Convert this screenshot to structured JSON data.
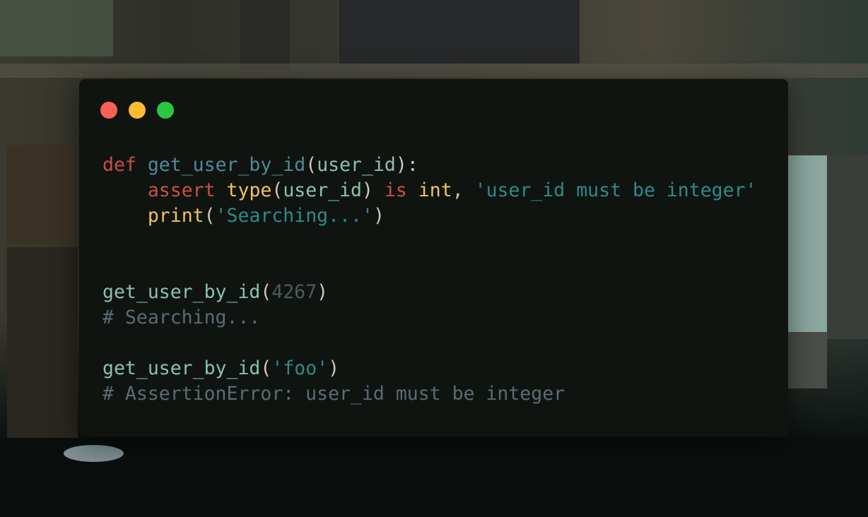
{
  "window": {
    "background": "#0f1411",
    "controls": [
      {
        "name": "close",
        "color": "#fe5f57"
      },
      {
        "name": "minimize",
        "color": "#febc2e"
      },
      {
        "name": "maximize",
        "color": "#28c840"
      }
    ]
  },
  "code": {
    "language": "python",
    "lines": [
      [
        {
          "t": "def",
          "k": "keyword"
        },
        {
          "t": " ",
          "k": "punct"
        },
        {
          "t": "get_user_by_id",
          "k": "function"
        },
        {
          "t": "(",
          "k": "punct"
        },
        {
          "t": "user_id",
          "k": "name"
        },
        {
          "t": "):",
          "k": "punct"
        }
      ],
      [
        {
          "t": "    ",
          "k": "punct"
        },
        {
          "t": "assert",
          "k": "keyword"
        },
        {
          "t": " ",
          "k": "punct"
        },
        {
          "t": "type",
          "k": "builtin"
        },
        {
          "t": "(",
          "k": "punct"
        },
        {
          "t": "user_id",
          "k": "name"
        },
        {
          "t": ") ",
          "k": "punct"
        },
        {
          "t": "is",
          "k": "keyword"
        },
        {
          "t": " ",
          "k": "punct"
        },
        {
          "t": "int",
          "k": "builtin"
        },
        {
          "t": ", ",
          "k": "punct"
        },
        {
          "t": "'user_id must be integer'",
          "k": "string"
        }
      ],
      [
        {
          "t": "    ",
          "k": "punct"
        },
        {
          "t": "print",
          "k": "builtin"
        },
        {
          "t": "(",
          "k": "punct"
        },
        {
          "t": "'Searching...'",
          "k": "string"
        },
        {
          "t": ")",
          "k": "punct"
        }
      ],
      [],
      [],
      [
        {
          "t": "get_user_by_id",
          "k": "name"
        },
        {
          "t": "(",
          "k": "punct"
        },
        {
          "t": "4267",
          "k": "number"
        },
        {
          "t": ")",
          "k": "punct"
        }
      ],
      [
        {
          "t": "# Searching...",
          "k": "comment"
        }
      ],
      [],
      [
        {
          "t": "get_user_by_id",
          "k": "name"
        },
        {
          "t": "(",
          "k": "punct"
        },
        {
          "t": "'foo'",
          "k": "string"
        },
        {
          "t": ")",
          "k": "punct"
        }
      ],
      [
        {
          "t": "# AssertionError: user_id must be integer",
          "k": "comment"
        }
      ]
    ]
  }
}
